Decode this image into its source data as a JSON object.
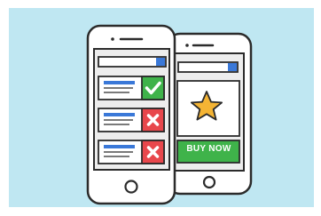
{
  "colors": {
    "background": "#bfe7f2",
    "outline": "#2b2b2b",
    "phone_body": "#ffffff",
    "screen": "#ededed",
    "accent_blue": "#3a78d8",
    "green": "#3fb34a",
    "red": "#e8474c",
    "star": "#f4b434"
  },
  "back_phone": {
    "search_bar_icon": "blue-square",
    "offer_icon": "star-icon",
    "buy_button": {
      "label": "BUY NOW",
      "color": "#3fb34a"
    }
  },
  "front_phone": {
    "search_bar_icon": "blue-square",
    "items": [
      {
        "status_icon": "check-icon",
        "status_color": "#3fb34a"
      },
      {
        "status_icon": "cross-icon",
        "status_color": "#e8474c"
      },
      {
        "status_icon": "cross-icon",
        "status_color": "#e8474c"
      }
    ]
  }
}
